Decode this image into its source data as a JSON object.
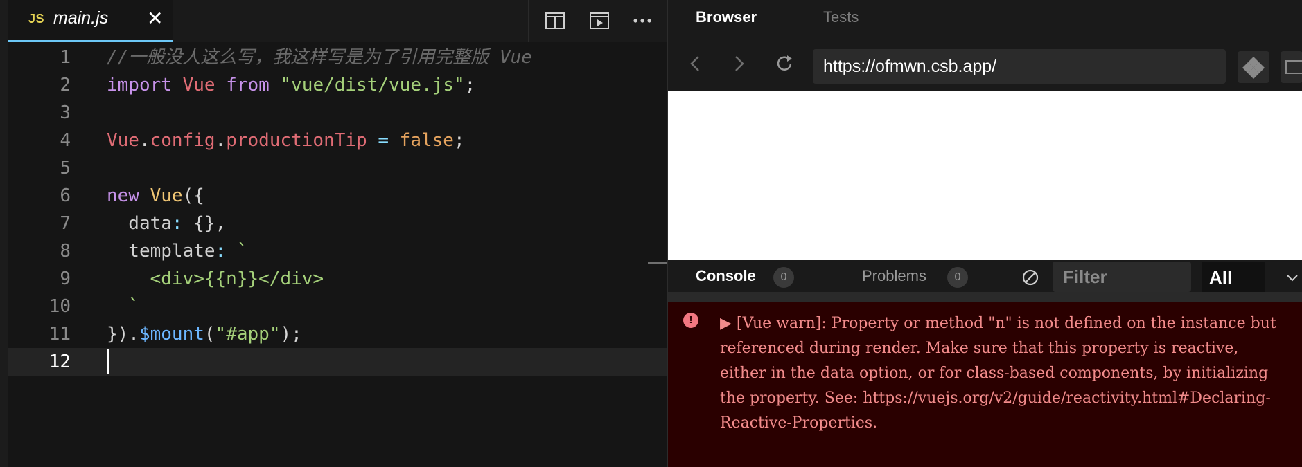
{
  "editor": {
    "file_badge": "JS",
    "file_name": "main.js",
    "close_glyph": "✕",
    "actions": [
      "split-view-icon",
      "preview-icon",
      "more-icon"
    ],
    "lines": [
      {
        "n": "1",
        "tokens": [
          {
            "t": "//一般没人这么写，我这样写是为了引用完整版 Vue",
            "c": "comment"
          }
        ]
      },
      {
        "n": "2",
        "tokens": [
          {
            "t": "import",
            "c": "kw"
          },
          {
            "t": " ",
            "c": "plain"
          },
          {
            "t": "Vue",
            "c": "var"
          },
          {
            "t": " ",
            "c": "plain"
          },
          {
            "t": "from",
            "c": "kw"
          },
          {
            "t": " ",
            "c": "plain"
          },
          {
            "t": "\"vue/dist/vue.js\"",
            "c": "str"
          },
          {
            "t": ";",
            "c": "punct"
          }
        ]
      },
      {
        "n": "3",
        "tokens": []
      },
      {
        "n": "4",
        "tokens": [
          {
            "t": "Vue",
            "c": "var"
          },
          {
            "t": ".",
            "c": "punct"
          },
          {
            "t": "config",
            "c": "prop"
          },
          {
            "t": ".",
            "c": "punct"
          },
          {
            "t": "productionTip",
            "c": "prop"
          },
          {
            "t": " ",
            "c": "plain"
          },
          {
            "t": "=",
            "c": "op"
          },
          {
            "t": " ",
            "c": "plain"
          },
          {
            "t": "false",
            "c": "bool"
          },
          {
            "t": ";",
            "c": "punct"
          }
        ]
      },
      {
        "n": "5",
        "tokens": []
      },
      {
        "n": "6",
        "tokens": [
          {
            "t": "new",
            "c": "kw"
          },
          {
            "t": " ",
            "c": "plain"
          },
          {
            "t": "Vue",
            "c": "class"
          },
          {
            "t": "({",
            "c": "punct"
          }
        ]
      },
      {
        "n": "7",
        "tokens": [
          {
            "t": "  data",
            "c": "plain"
          },
          {
            "t": ":",
            "c": "op"
          },
          {
            "t": " {},",
            "c": "punct"
          }
        ]
      },
      {
        "n": "8",
        "tokens": [
          {
            "t": "  template",
            "c": "plain"
          },
          {
            "t": ":",
            "c": "op"
          },
          {
            "t": " `",
            "c": "str"
          }
        ]
      },
      {
        "n": "9",
        "tokens": [
          {
            "t": "    <div>{{n}}</div>",
            "c": "str"
          }
        ]
      },
      {
        "n": "10",
        "tokens": [
          {
            "t": "  `",
            "c": "str"
          }
        ]
      },
      {
        "n": "11",
        "tokens": [
          {
            "t": "}).",
            "c": "punct"
          },
          {
            "t": "$mount",
            "c": "fn"
          },
          {
            "t": "(",
            "c": "punct"
          },
          {
            "t": "\"#app\"",
            "c": "str"
          },
          {
            "t": ");",
            "c": "punct"
          }
        ]
      },
      {
        "n": "12",
        "tokens": [],
        "active": true
      }
    ]
  },
  "preview": {
    "tabs": [
      {
        "label": "Browser",
        "active": true
      },
      {
        "label": "Tests",
        "active": false
      }
    ],
    "url": "https://ofmwn.csb.app/",
    "console": {
      "tab_console": "Console",
      "console_count": "0",
      "tab_problems": "Problems",
      "problems_count": "0",
      "filter_placeholder": "Filter",
      "level": "All",
      "error_message": "▶ [Vue warn]: Property or method \"n\" is not defined on the instance but referenced during render. Make sure that this property is reactive, either in the data option, or for class-based components, by initializing the property. See: https://vuejs.org/v2/guide/reactivity.html#Declaring-Reactive-Properties."
    }
  },
  "colors": {
    "accent_tab_underline": "#6cc7f6",
    "error_background": "#2a0000",
    "error_text": "#f28b8b"
  }
}
